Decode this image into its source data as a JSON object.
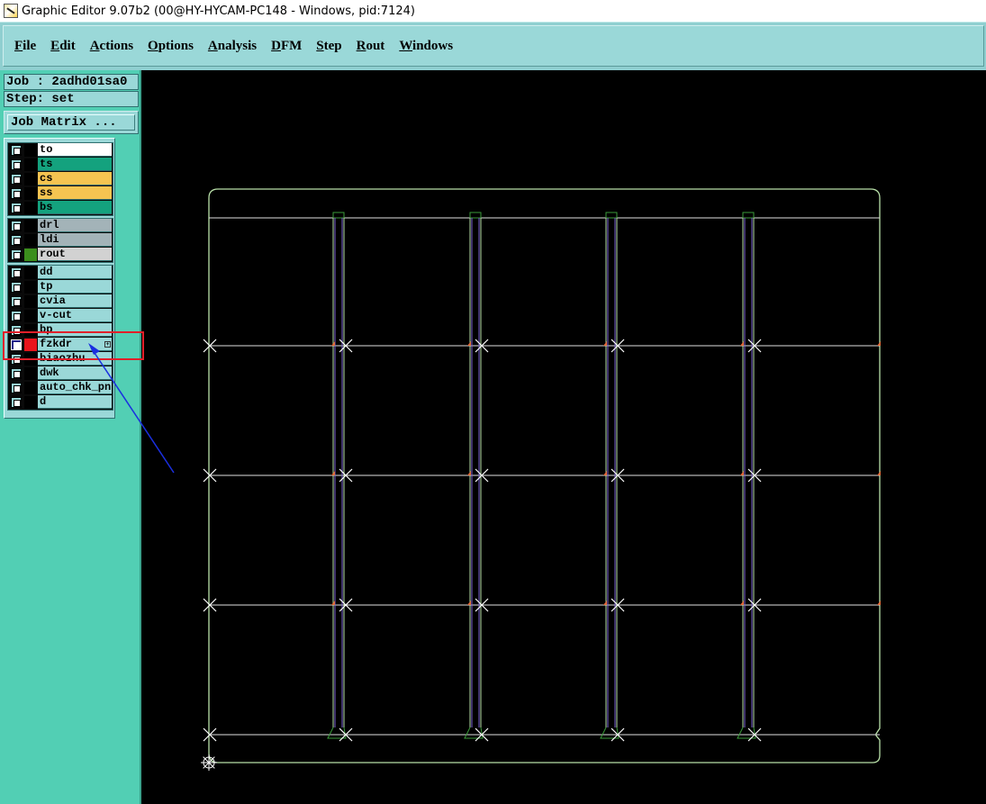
{
  "window": {
    "title": "Graphic Editor 9.07b2 (00@HY-HYCAM-PC148 - Windows, pid:7124)"
  },
  "menu": [
    {
      "label": "File"
    },
    {
      "label": "Edit"
    },
    {
      "label": "Actions"
    },
    {
      "label": "Options"
    },
    {
      "label": "Analysis"
    },
    {
      "label": "DFM"
    },
    {
      "label": "Step"
    },
    {
      "label": "Rout"
    },
    {
      "label": "Windows"
    }
  ],
  "job": {
    "text": "Job : 2adhd01sa0"
  },
  "step": {
    "text": "Step: set"
  },
  "job_matrix_button": "Job Matrix ...",
  "layer_groups": [
    {
      "layers": [
        {
          "name": "to",
          "color": "#ffffff",
          "swatch": "#000000"
        },
        {
          "name": "ts",
          "color": "#14a27e",
          "swatch": "#000000"
        },
        {
          "name": "cs",
          "color": "#f5c451",
          "swatch": "#000000"
        },
        {
          "name": "ss",
          "color": "#f5c451",
          "swatch": "#000000"
        },
        {
          "name": "bs",
          "color": "#14a27e",
          "swatch": "#000000"
        }
      ]
    },
    {
      "layers": [
        {
          "name": "drl",
          "color": "#a3b3b8",
          "swatch": "#000000"
        },
        {
          "name": "ldi",
          "color": "#a3b3b8",
          "swatch": "#000000"
        },
        {
          "name": "rout",
          "color": "#d2d2d2",
          "swatch": "#3b8e1d"
        }
      ]
    },
    {
      "layers": [
        {
          "name": "dd",
          "color": "#9ad8d8",
          "swatch": "#000000"
        },
        {
          "name": "tp",
          "color": "#9ad8d8",
          "swatch": "#000000"
        },
        {
          "name": "cvia",
          "color": "#9ad8d8",
          "swatch": "#000000"
        },
        {
          "name": "v-cut",
          "color": "#9ad8d8",
          "swatch": "#000000"
        },
        {
          "name": "bp",
          "color": "#9ad8d8",
          "swatch": "#000000"
        },
        {
          "name": "fzkdr",
          "color": "#9ad8d8",
          "swatch": "#e8141c",
          "active": true
        },
        {
          "name": "biaozhu",
          "color": "#9ad8d8",
          "swatch": "#000000"
        },
        {
          "name": "dwk",
          "color": "#9ad8d8",
          "swatch": "#000000"
        },
        {
          "name": "auto_chk_pn",
          "color": "#9ad8d8",
          "swatch": "#000000"
        },
        {
          "name": "d",
          "color": "#9ad8d8",
          "swatch": "#000000"
        }
      ]
    }
  ],
  "colors": {
    "menubar": "#9ad8d8",
    "left_panel": "#52cfb4",
    "canvas_bg": "#000000",
    "board_outline": "#b8e0a8",
    "grid_lines": "#e0e0e0",
    "rail_lines": "#7a62d4",
    "cross_marks": "#ffffff",
    "corner_marks": "#e06a3a",
    "highlight": "#e0202a",
    "annotation_arrow": "#1a2fe0"
  }
}
